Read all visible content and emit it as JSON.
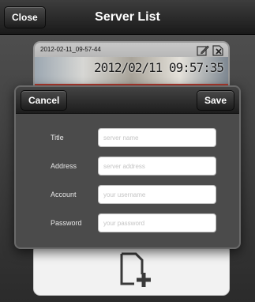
{
  "navbar": {
    "title": "Server List",
    "close_label": "Close"
  },
  "server_card": {
    "name": "2012-02-11_09-57-44",
    "timestamp_overlay": "2012/02/11 09:57:35"
  },
  "dialog": {
    "cancel_label": "Cancel",
    "save_label": "Save",
    "fields": [
      {
        "label": "Title",
        "placeholder": "server name",
        "value": ""
      },
      {
        "label": "Address",
        "placeholder": "server address",
        "value": ""
      },
      {
        "label": "Account",
        "placeholder": "your username",
        "value": ""
      },
      {
        "label": "Password",
        "placeholder": "your password",
        "value": ""
      }
    ]
  },
  "icons": {
    "edit": "pencil-edit-icon",
    "delete": "delete-x-icon",
    "add": "add-document-icon"
  }
}
